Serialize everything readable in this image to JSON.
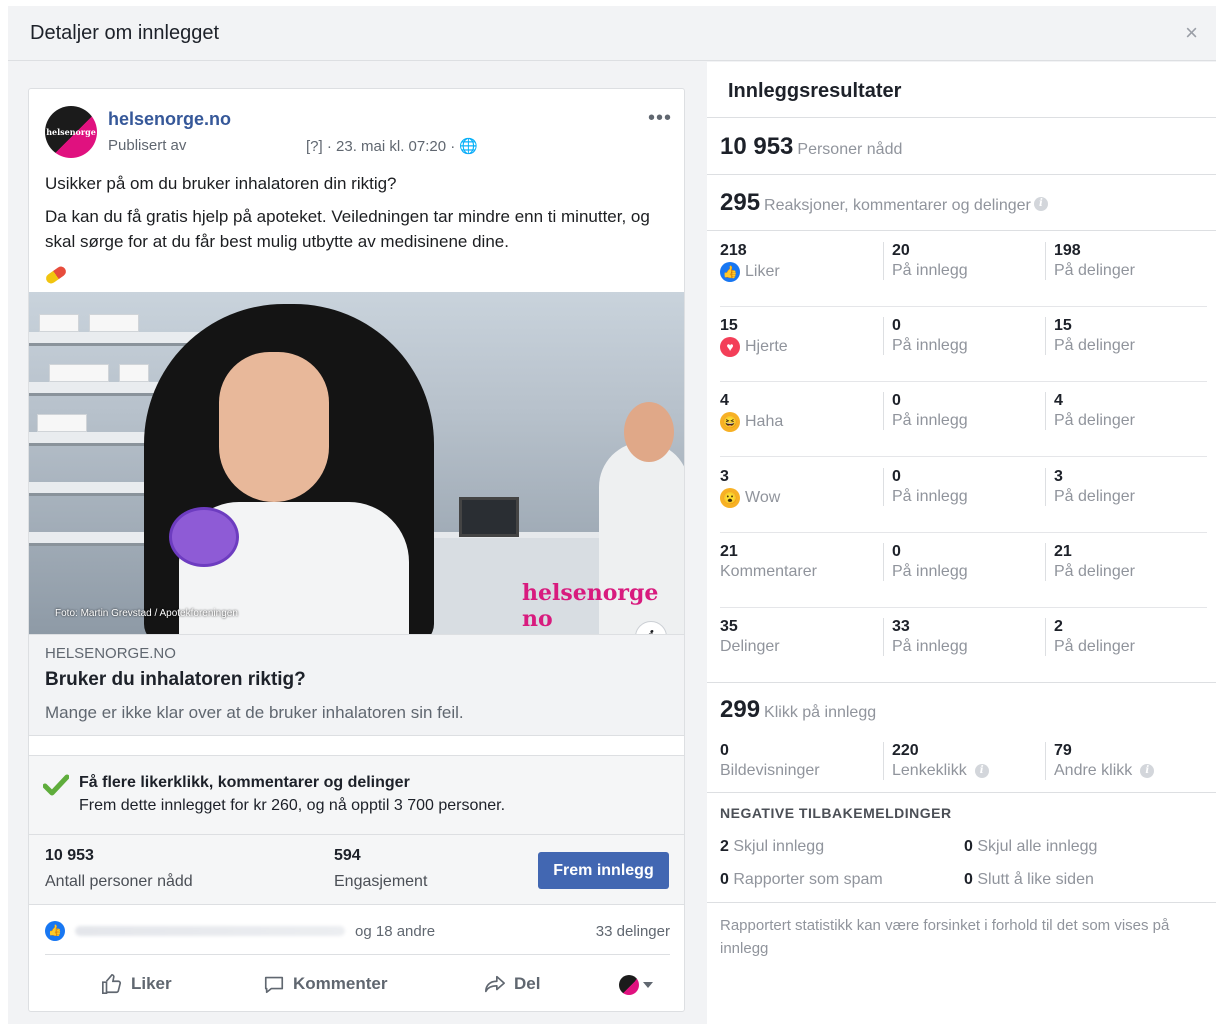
{
  "dialog": {
    "title": "Detaljer om innlegget",
    "close": "×"
  },
  "post": {
    "avatar_text": "helsenorge",
    "page_name": "helsenorge.no",
    "published": "Publisert av",
    "meta": "[?] · 23. mai kl. 07:20 · ",
    "more": "•••",
    "text1": "Usikker på om du bruker inhalatoren din riktig?",
    "text2": "Da kan du få gratis hjelp på apoteket. Veiledningen tar mindre enn ti minutter, og skal sørge for at du får best mulig utbytte av medisinene dine.",
    "photo_credit": "Foto: Martin Grevstad / Apotekforeningen",
    "photo_brand": "helsenorge no",
    "info_icon": "i",
    "link_domain": "HELSENORGE.NO",
    "link_title": "Bruker du inhalatoren riktig?",
    "link_desc": "Mange er ikke klar over at de bruker inhalatoren sin feil.",
    "boost_title": "Få flere likerklikk, kommentarer og delinger",
    "boost_desc": "Frem dette innlegget for kr 260, og nå opptil 3 700 personer.",
    "reach_value": "10 953",
    "reach_label": "Antall personer nådd",
    "engagement_value": "594",
    "engagement_label": "Engasjement",
    "boost_button": "Frem innlegg",
    "others": "og 18 andre",
    "shares": "33 delinger",
    "action_like": "Liker",
    "action_comment": "Kommenter",
    "action_share": "Del"
  },
  "results": {
    "title": "Innleggsresultater",
    "reach": {
      "value": "10 953",
      "label": "Personer nådd"
    },
    "reactions": {
      "value": "295",
      "label": "Reaksjoner, kommentarer og delinger"
    },
    "rows": [
      {
        "total": "218",
        "label": "Liker",
        "icon": "like-icon",
        "on_post": "20",
        "on_shares": "198"
      },
      {
        "total": "15",
        "label": "Hjerte",
        "icon": "heart-icon",
        "on_post": "0",
        "on_shares": "15"
      },
      {
        "total": "4",
        "label": "Haha",
        "icon": "haha-icon",
        "on_post": "0",
        "on_shares": "4"
      },
      {
        "total": "3",
        "label": "Wow",
        "icon": "wow-icon",
        "on_post": "0",
        "on_shares": "3"
      },
      {
        "total": "21",
        "label": "Kommentarer",
        "icon": "",
        "on_post": "0",
        "on_shares": "21"
      },
      {
        "total": "35",
        "label": "Delinger",
        "icon": "",
        "on_post": "33",
        "on_shares": "2"
      }
    ],
    "on_post_label": "På innlegg",
    "on_shares_label": "På delinger",
    "clicks": {
      "value": "299",
      "label": "Klikk på innlegg"
    },
    "click_cols": [
      {
        "value": "0",
        "label": "Bildevisninger"
      },
      {
        "value": "220",
        "label": "Lenkeklikk"
      },
      {
        "value": "79",
        "label": "Andre klikk"
      }
    ],
    "negative_title": "NEGATIVE TILBAKEMELDINGER",
    "negative": [
      {
        "value": "2",
        "label": "Skjul innlegg"
      },
      {
        "value": "0",
        "label": "Skjul alle innlegg"
      },
      {
        "value": "0",
        "label": "Rapporter som spam"
      },
      {
        "value": "0",
        "label": "Slutt å like siden"
      }
    ],
    "note": "Rapportert statistikk kan være forsinket i forhold til det som vises på innlegg",
    "tip_icon": "i"
  },
  "colors": {
    "accent": "#4267b2",
    "link": "#365899",
    "brand": "#d81b7e"
  }
}
